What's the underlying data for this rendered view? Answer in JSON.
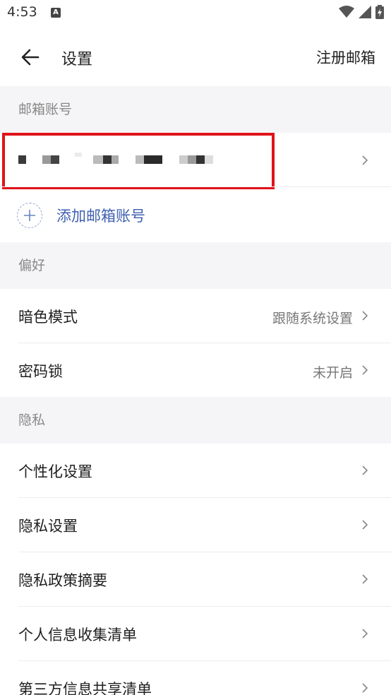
{
  "status_bar": {
    "time": "4:53",
    "notification_icon": "A"
  },
  "header": {
    "title": "设置",
    "register_label": "注册邮箱"
  },
  "sections": {
    "account": {
      "title": "邮箱账号",
      "add_label": "添加邮箱账号"
    },
    "preferences": {
      "title": "偏好",
      "dark_mode_label": "暗色模式",
      "dark_mode_value": "跟随系统设置",
      "password_lock_label": "密码锁",
      "password_lock_value": "未开启"
    },
    "privacy": {
      "title": "隐私",
      "personalization_label": "个性化设置",
      "privacy_settings_label": "隐私设置",
      "privacy_policy_label": "隐私政策摘要",
      "personal_info_label": "个人信息收集清单",
      "third_party_label": "第三方信息共享清单"
    }
  },
  "colors": {
    "accent_blue": "#3f5fb0",
    "highlight_red": "#e1131a",
    "section_bg": "#f5f5f7"
  }
}
